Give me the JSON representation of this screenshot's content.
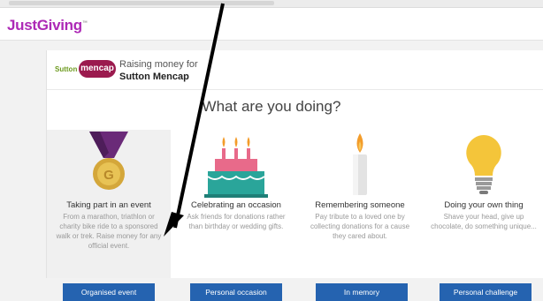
{
  "brand": {
    "logo_text": "JustGiving",
    "trademark": "™"
  },
  "charity": {
    "logo_left": "Sutton",
    "logo_badge": "mencap",
    "raising_label": "Raising money for",
    "name": "Sutton Mencap"
  },
  "question": "What are you doing?",
  "options": [
    {
      "title": "Taking part in an event",
      "description": "From a marathon, triathlon or charity bike ride to a sponsored walk or trek. Raise money for any official event.",
      "button": "Organised event",
      "icon": "medal-icon",
      "selected": true
    },
    {
      "title": "Celebrating an occasion",
      "description": "Ask friends for donations rather than birthday or wedding gifts.",
      "button": "Personal occasion",
      "icon": "cake-icon",
      "selected": false
    },
    {
      "title": "Remembering someone",
      "description": "Pay tribute to a loved one by collecting donations for a cause they cared about.",
      "button": "In memory",
      "icon": "candle-icon",
      "selected": false
    },
    {
      "title": "Doing your own thing",
      "description": "Shave your head, give up chocolate, do something unique...",
      "button": "Personal challenge",
      "icon": "lightbulb-icon",
      "selected": false
    }
  ],
  "colors": {
    "brand_purple": "#ad29b6",
    "button_blue": "#2563b0",
    "mencap_red": "#9b1a4e",
    "medal_purple": "#6a2a78",
    "cake_teal": "#2aa59a",
    "flame_orange": "#f39c2a",
    "bulb_yellow": "#f4c53a"
  }
}
